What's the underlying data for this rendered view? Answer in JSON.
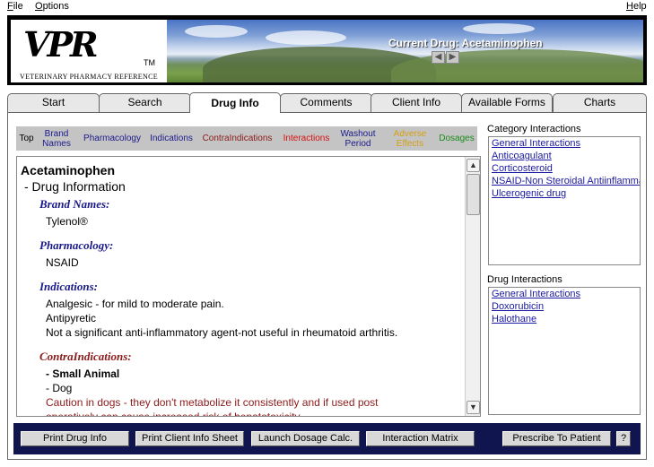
{
  "menu": {
    "file": "File",
    "options": "Options",
    "help": "Help"
  },
  "banner": {
    "logo_letters": "VPR",
    "logo_tm": "TM",
    "logo_subtitle": "VETERINARY PHARMACY REFERENCE",
    "current_drug_label": "Current Drug: Acetaminophen"
  },
  "tabs": [
    {
      "label": "Start"
    },
    {
      "label": "Search"
    },
    {
      "label": "Drug Info"
    },
    {
      "label": "Comments"
    },
    {
      "label": "Client Info"
    },
    {
      "label": "Available Forms"
    },
    {
      "label": "Charts"
    }
  ],
  "sections": [
    {
      "label": "Top",
      "color": "#000000"
    },
    {
      "label": "Brand Names",
      "color": "#1a1a8c"
    },
    {
      "label": "Pharmacology",
      "color": "#1a1a8c"
    },
    {
      "label": "Indications",
      "color": "#1a1a8c"
    },
    {
      "label": "ContraIndications",
      "color": "#8b1a1a"
    },
    {
      "label": "Interactions",
      "color": "#d81010"
    },
    {
      "label": "Washout Period",
      "color": "#1a1a8c"
    },
    {
      "label": "Adverse Effects",
      "color": "#d4a017"
    },
    {
      "label": "Dosages",
      "color": "#1a8c1a"
    }
  ],
  "content": {
    "drug_name": "Acetaminophen",
    "subtitle": "- Drug Information",
    "brand_names_heading": "Brand Names:",
    "brand_names": [
      "Tylenol®"
    ],
    "pharmacology_heading": "Pharmacology:",
    "pharmacology": [
      "NSAID"
    ],
    "indications_heading": "Indications:",
    "indications": [
      "Analgesic - for mild to moderate pain.",
      "Antipyretic",
      "Not a significant anti-inflammatory agent-not useful in rheumatoid arthritis."
    ],
    "contraindications_heading": "ContraIndications:",
    "contra_group": "- Small Animal",
    "contra_species": "- Dog",
    "contra_text": [
      "Caution in dogs - they don't metabolize it consistently and if used post",
      "operatively can cause increased risk of hepatotoxicity."
    ]
  },
  "category_interactions": {
    "label": "Category Interactions",
    "items": [
      "General Interactions",
      "Anticoagulant",
      "Corticosteroid",
      "NSAID-Non Steroidal Antiinflammatory",
      "Ulcerogenic drug"
    ]
  },
  "drug_interactions": {
    "label": "Drug Interactions",
    "items": [
      "General Interactions",
      "Doxorubicin",
      "Halothane"
    ]
  },
  "toolbar": {
    "print_drug_info": "Print Drug Info",
    "print_client_info": "Print Client Info Sheet",
    "launch_dosage": "Launch Dosage Calc.",
    "interaction_matrix": "Interaction Matrix",
    "prescribe": "Prescribe To Patient",
    "help": "?"
  }
}
